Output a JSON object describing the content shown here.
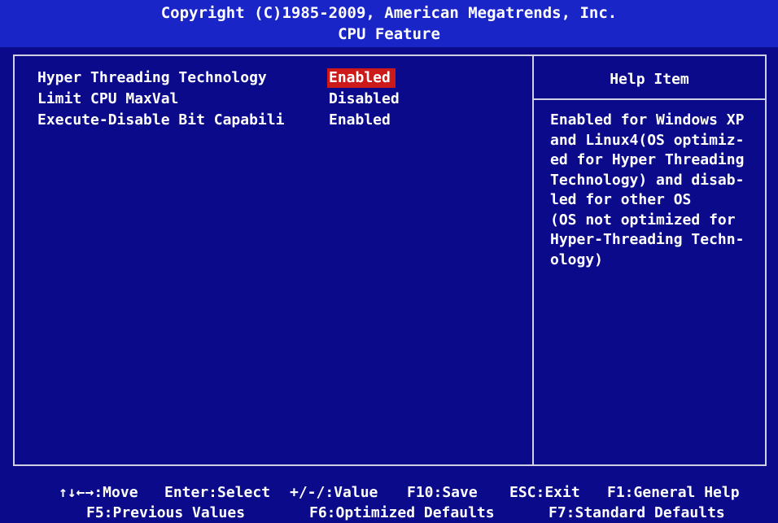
{
  "header": {
    "copyright": "Copyright (C)1985-2009, American Megatrends, Inc.",
    "title": "CPU Feature"
  },
  "settings": [
    {
      "label": "Hyper Threading Technology",
      "value": "Enabled",
      "selected": true
    },
    {
      "label": "Limit CPU MaxVal",
      "value": "Disabled",
      "selected": false
    },
    {
      "label": "Execute-Disable Bit Capabili",
      "value": "Enabled",
      "selected": false
    }
  ],
  "help": {
    "title": "Help Item",
    "lines": [
      "Enabled for Windows XP",
      "and Linux4(OS optimiz-",
      "ed for Hyper Threading",
      "Technology) and disab-",
      "led for other OS",
      "(OS not optimized for",
      "Hyper-Threading Techn-",
      "ology)"
    ]
  },
  "footer": {
    "move": "↑↓←→:Move",
    "select": "Enter:Select",
    "value": "+/-/:Value",
    "save": "F10:Save",
    "exit": "ESC:Exit",
    "general_help": "F1:General Help",
    "previous_values": "F5:Previous Values",
    "optimized_defaults": "F6:Optimized Defaults",
    "standard_defaults": "F7:Standard Defaults"
  },
  "colors": {
    "background": "#0a0a8a",
    "header": "#1a25c8",
    "highlight": "#cc1a1a",
    "text": "#ffffff"
  }
}
